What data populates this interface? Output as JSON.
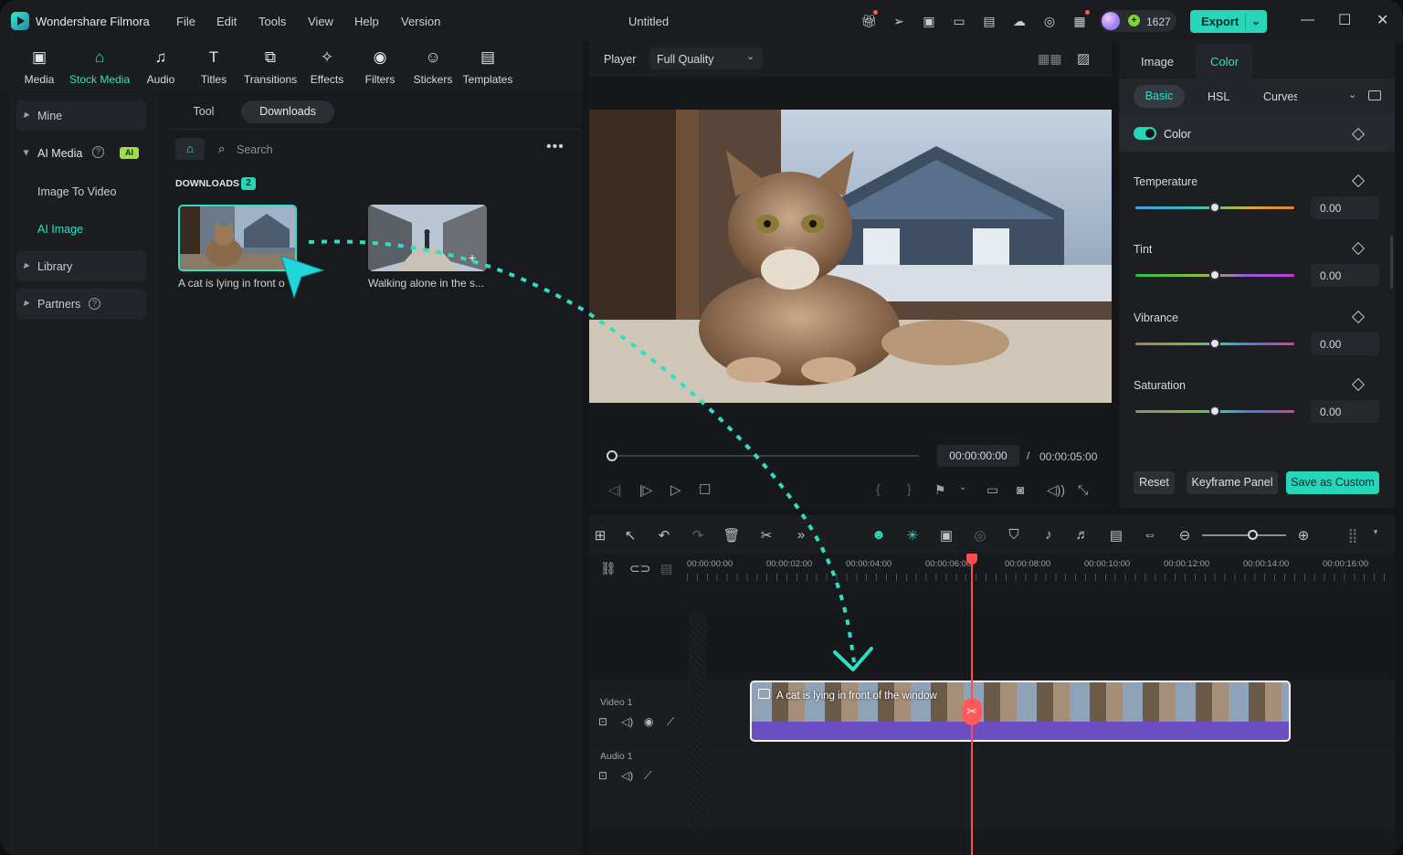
{
  "app": {
    "name": "Wondershare Filmora",
    "doc_title": "Untitled",
    "credits": "1627",
    "export_label": "Export"
  },
  "menu": [
    "File",
    "Edit",
    "Tools",
    "View",
    "Help",
    "Version"
  ],
  "toolbar": [
    {
      "label": "Media",
      "icon": "media-icon"
    },
    {
      "label": "Stock Media",
      "icon": "stock-media-icon",
      "active": true
    },
    {
      "label": "Audio",
      "icon": "audio-icon"
    },
    {
      "label": "Titles",
      "icon": "titles-icon"
    },
    {
      "label": "Transitions",
      "icon": "transitions-icon"
    },
    {
      "label": "Effects",
      "icon": "effects-icon"
    },
    {
      "label": "Filters",
      "icon": "filters-icon"
    },
    {
      "label": "Stickers",
      "icon": "stickers-icon"
    },
    {
      "label": "Templates",
      "icon": "templates-icon"
    }
  ],
  "sidebar": {
    "mine": "Mine",
    "ai_media": "AI Media",
    "ai_badge": "AI",
    "sub": [
      "Image To Video",
      "AI Image"
    ],
    "library": "Library",
    "partners": "Partners"
  },
  "media_tabs": [
    "Tool",
    "Downloads"
  ],
  "search": {
    "placeholder": "Search"
  },
  "downloads": {
    "heading": "DOWNLOADS",
    "count": "2",
    "items": [
      {
        "caption": "A cat is lying in front o"
      },
      {
        "caption": "Walking alone in the s..."
      }
    ]
  },
  "player": {
    "label": "Player",
    "quality": "Full Quality",
    "timecode": "00:00:00:00",
    "separator": "/",
    "duration": "00:00:05:00"
  },
  "inspector": {
    "tabs": [
      "Image",
      "Color"
    ],
    "subtabs": [
      "Basic",
      "HSL",
      "Curves"
    ],
    "toggle_label": "Color",
    "params": [
      {
        "label": "Temperature",
        "value": "0.00",
        "level": 0.5
      },
      {
        "label": "Tint",
        "value": "0.00",
        "level": 0.5
      },
      {
        "label": "Vibrance",
        "value": "0.00",
        "level": 0.5
      },
      {
        "label": "Saturation",
        "value": "0.00",
        "level": 0.5
      }
    ],
    "buttons": [
      "Reset",
      "Keyframe Panel",
      "Save as Custom"
    ]
  },
  "timeline": {
    "ruler": [
      "00:00:00:00",
      "00:00:02:00",
      "00:00:04:00",
      "00:00:06:00",
      "00:00:08:00",
      "00:00:10:00",
      "00:00:12:00",
      "00:00:14:00",
      "00:00:16:00"
    ],
    "video_track": "Video 1",
    "audio_track": "Audio 1",
    "clip_title": "A cat is lying in front of the window"
  },
  "colors": {
    "accent": "#2ee0c3",
    "playhead": "#ff4d4d",
    "clip": "#6b4fc2"
  }
}
